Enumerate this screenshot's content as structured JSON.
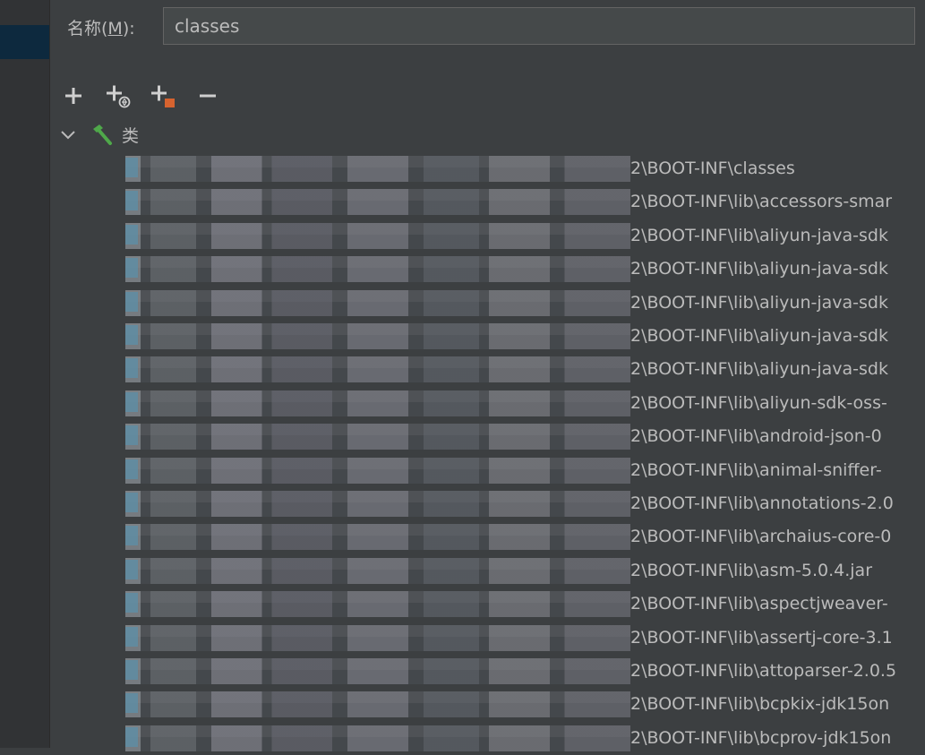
{
  "name_field": {
    "label": "名称(",
    "mnemonic": "M",
    "label_suffix": "):",
    "value": "classes"
  },
  "toolbar": {
    "add": "add-icon",
    "add_url": "add-url-icon",
    "add_folder": "add-folder-icon",
    "remove": "remove-icon"
  },
  "tree": {
    "root_label": "类",
    "rows": [
      "2\\BOOT-INF\\classes",
      "2\\BOOT-INF\\lib\\accessors-smar",
      "2\\BOOT-INF\\lib\\aliyun-java-sdk",
      "2\\BOOT-INF\\lib\\aliyun-java-sdk",
      "2\\BOOT-INF\\lib\\aliyun-java-sdk",
      "2\\BOOT-INF\\lib\\aliyun-java-sdk",
      "2\\BOOT-INF\\lib\\aliyun-java-sdk",
      "2\\BOOT-INF\\lib\\aliyun-sdk-oss-",
      "2\\BOOT-INF\\lib\\android-json-0",
      "2\\BOOT-INF\\lib\\animal-sniffer-",
      "2\\BOOT-INF\\lib\\annotations-2.0",
      "2\\BOOT-INF\\lib\\archaius-core-0",
      "2\\BOOT-INF\\lib\\asm-5.0.4.jar",
      "2\\BOOT-INF\\lib\\aspectjweaver-",
      "2\\BOOT-INF\\lib\\assertj-core-3.1",
      "2\\BOOT-INF\\lib\\attoparser-2.0.5",
      "2\\BOOT-INF\\lib\\bcpkix-jdk15on",
      "2\\BOOT-INF\\lib\\bcprov-jdk15on"
    ]
  }
}
